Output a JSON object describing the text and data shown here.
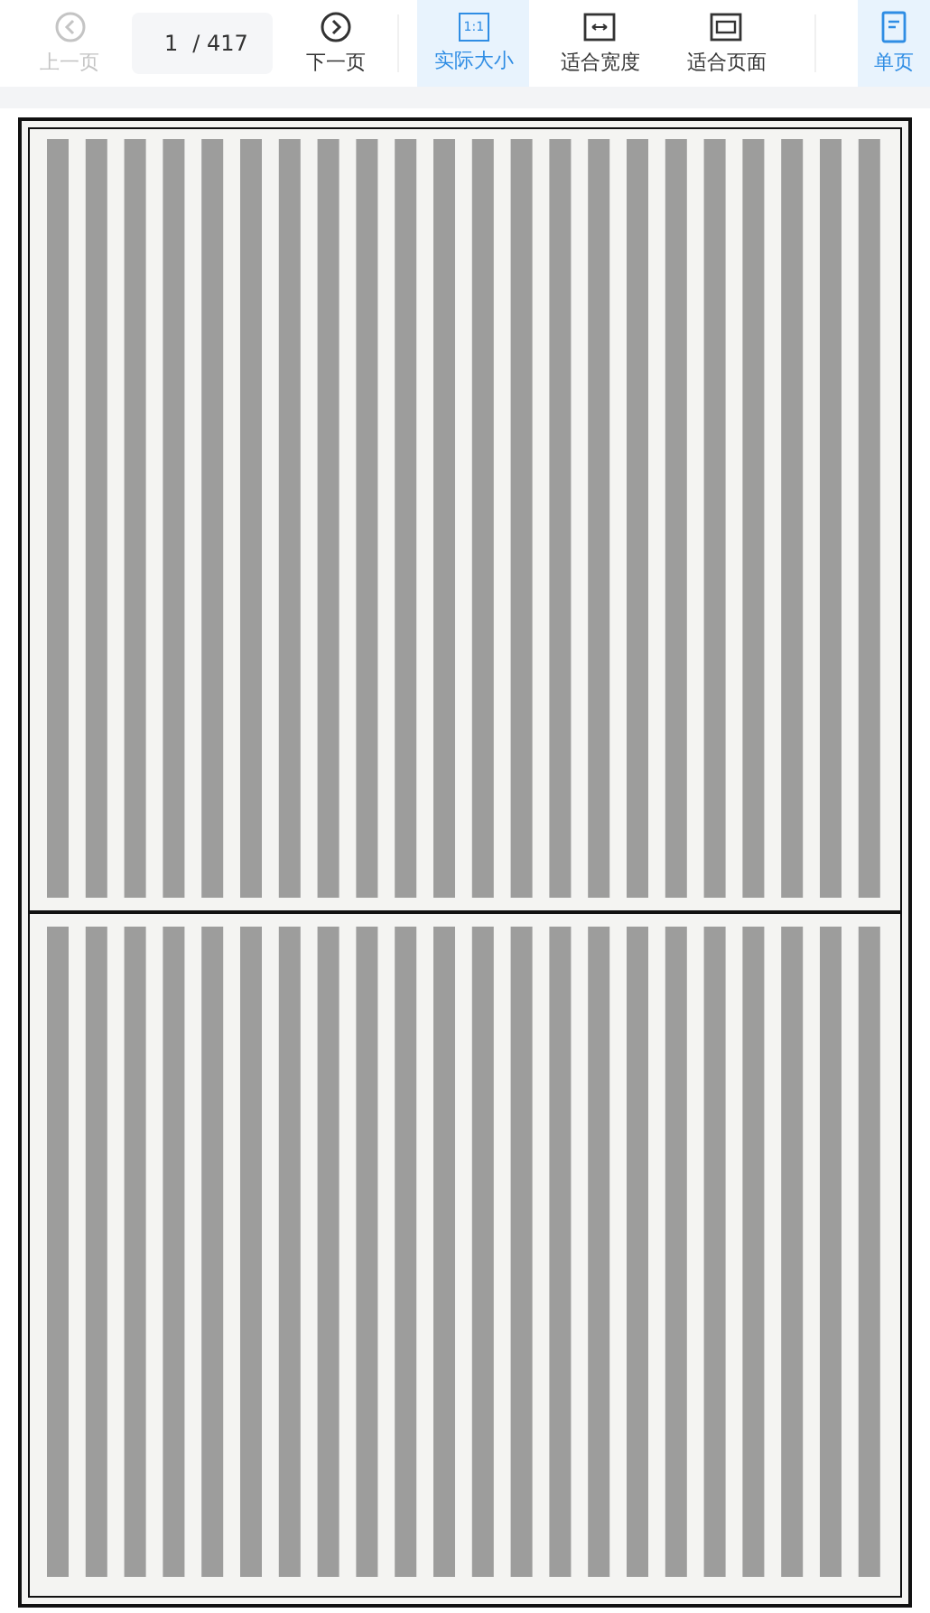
{
  "toolbar": {
    "items": [
      {
        "kind": "prev",
        "label": "上一页",
        "disabled": true
      },
      {
        "kind": "page",
        "current": "1",
        "total": "/ 417"
      },
      {
        "kind": "next",
        "label": "下一页",
        "disabled": false
      },
      {
        "kind": "divider"
      },
      {
        "kind": "actual-size",
        "label": "实际大小",
        "icon_text": "1:1",
        "selected": true
      },
      {
        "kind": "fit-width",
        "label": "适合宽度",
        "selected": false
      },
      {
        "kind": "fit-page",
        "label": "适合页面",
        "selected": false
      },
      {
        "kind": "divider"
      },
      {
        "kind": "single-page",
        "label": "单页",
        "selected": true
      }
    ]
  }
}
